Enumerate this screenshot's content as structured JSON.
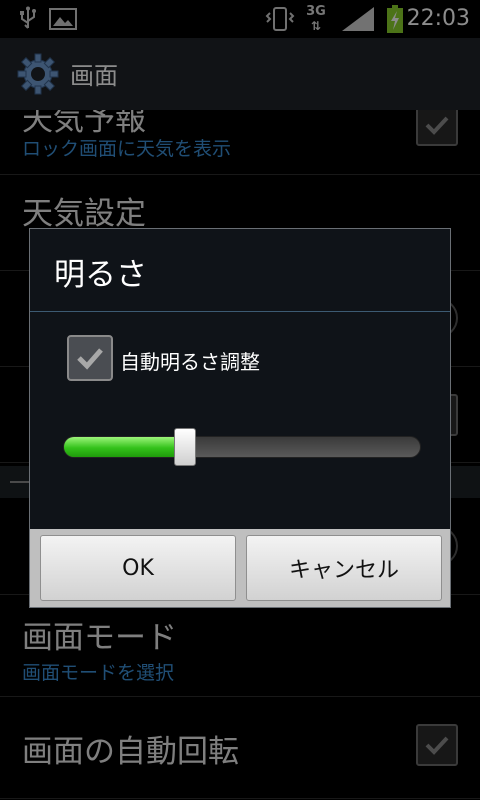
{
  "status_bar": {
    "time": "22:03",
    "network": "3G",
    "icons": [
      "usb-icon",
      "image-icon",
      "vibrate-icon",
      "network-3g-icon",
      "signal-icon",
      "battery-charging-icon"
    ]
  },
  "action_bar": {
    "title": "画面",
    "icon": "gear-icon"
  },
  "settings": {
    "items": [
      {
        "title": "天気予報",
        "subtitle": "ロック画面に天気を表示",
        "control": "checkbox",
        "checked": true
      },
      {
        "title": "天気設定",
        "subtitle": "",
        "control": "none"
      },
      {
        "title": "",
        "subtitle": "",
        "control": "radio"
      },
      {
        "title": "",
        "subtitle": "",
        "control": "checkbox"
      },
      {
        "title": "",
        "subtitle": "",
        "control": "radio"
      },
      {
        "title": "画面モード",
        "subtitle": "画面モードを選択",
        "control": "none"
      },
      {
        "title": "画面の自動回転",
        "subtitle": "",
        "control": "checkbox",
        "checked": true
      }
    ]
  },
  "dialog": {
    "title": "明るさ",
    "auto_checkbox_label": "自動明るさ調整",
    "auto_checked": true,
    "brightness_level": 0.34,
    "ok_label": "OK",
    "cancel_label": "キャンセル"
  },
  "colors": {
    "accent_blue": "#3b8fd6",
    "slider_green": "#33c21a",
    "action_bar": "#202429"
  }
}
